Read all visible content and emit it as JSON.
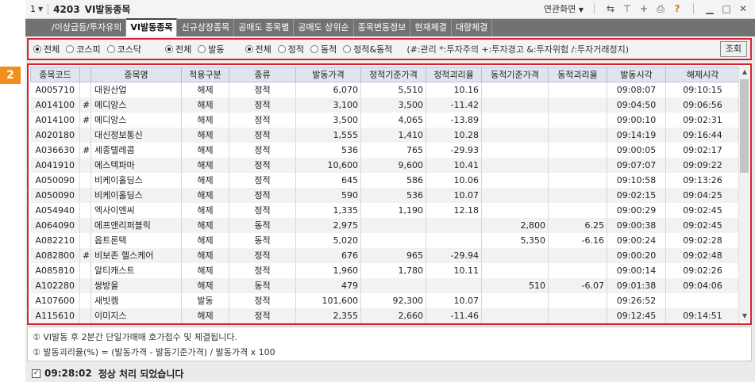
{
  "titlebar": {
    "screen_number": "1",
    "screen_code": "4203",
    "title": "VI발동종목",
    "linked_screen": "연관화면"
  },
  "icons": {
    "dropdown": "chevron-down-icon",
    "link": "link-icon",
    "pin": "pin-icon",
    "add": "plus-icon",
    "print": "print-icon",
    "help": "question-icon",
    "minimize": "minimize-icon",
    "maximize": "maximize-icon",
    "close": "close-icon"
  },
  "markers": [
    "1",
    "2"
  ],
  "tabs": [
    {
      "label": "/이상급등/투자유의",
      "active": false
    },
    {
      "label": "VI발동종목",
      "active": true
    },
    {
      "label": "신규상장종목",
      "active": false
    },
    {
      "label": "공매도 종목별",
      "active": false
    },
    {
      "label": "공매도 상위순",
      "active": false
    },
    {
      "label": "종목변동정보",
      "active": false
    },
    {
      "label": "현재체결",
      "active": false
    },
    {
      "label": "대량체결",
      "active": false
    }
  ],
  "filters": {
    "market": [
      {
        "label": "전체",
        "checked": true
      },
      {
        "label": "코스피",
        "checked": false
      },
      {
        "label": "코스닥",
        "checked": false
      }
    ],
    "status": [
      {
        "label": "전체",
        "checked": true
      },
      {
        "label": "발동",
        "checked": false
      }
    ],
    "type": [
      {
        "label": "전체",
        "checked": true
      },
      {
        "label": "정적",
        "checked": false
      },
      {
        "label": "동적",
        "checked": false
      },
      {
        "label": "정적&동적",
        "checked": false
      }
    ],
    "legend": "(#:관리 *:투자주의 +:투자경고 &:투자위험 /:투자거래정지)",
    "query_button": "조회"
  },
  "table": {
    "columns": [
      "종목코드",
      "",
      "종목명",
      "적용구분",
      "종류",
      "발동가격",
      "정적기준가격",
      "정적괴리율",
      "동적기준가격",
      "동적괴리율",
      "발동시각",
      "해제시각"
    ],
    "rows": [
      [
        "A005710",
        "",
        "대원산업",
        "해제",
        "정적",
        "6,070",
        "5,510",
        "10.16",
        "",
        "",
        "09:08:07",
        "09:10:15"
      ],
      [
        "A014100",
        "#",
        "메디앙스",
        "해제",
        "정적",
        "3,100",
        "3,500",
        "-11.42",
        "",
        "",
        "09:04:50",
        "09:06:56"
      ],
      [
        "A014100",
        "#",
        "메디앙스",
        "해제",
        "정적",
        "3,500",
        "4,065",
        "-13.89",
        "",
        "",
        "09:00:10",
        "09:02:31"
      ],
      [
        "A020180",
        "",
        "대신정보통신",
        "해제",
        "정적",
        "1,555",
        "1,410",
        "10.28",
        "",
        "",
        "09:14:19",
        "09:16:44"
      ],
      [
        "A036630",
        "#",
        "세종텔레콤",
        "해제",
        "정적",
        "536",
        "765",
        "-29.93",
        "",
        "",
        "09:00:05",
        "09:02:17"
      ],
      [
        "A041910",
        "",
        "에스텍파마",
        "해제",
        "정적",
        "10,600",
        "9,600",
        "10.41",
        "",
        "",
        "09:07:07",
        "09:09:22"
      ],
      [
        "A050090",
        "",
        "비케이홀딩스",
        "해제",
        "정적",
        "645",
        "586",
        "10.06",
        "",
        "",
        "09:10:58",
        "09:13:26"
      ],
      [
        "A050090",
        "",
        "비케이홀딩스",
        "해제",
        "정적",
        "590",
        "536",
        "10.07",
        "",
        "",
        "09:02:15",
        "09:04:25"
      ],
      [
        "A054940",
        "",
        "엑사이엔씨",
        "해제",
        "정적",
        "1,335",
        "1,190",
        "12.18",
        "",
        "",
        "09:00:29",
        "09:02:45"
      ],
      [
        "A064090",
        "",
        "에프앤리퍼블릭",
        "해제",
        "동적",
        "2,975",
        "",
        "",
        "2,800",
        "6.25",
        "09:00:38",
        "09:02:45"
      ],
      [
        "A082210",
        "",
        "옵트론텍",
        "해제",
        "동적",
        "5,020",
        "",
        "",
        "5,350",
        "-6.16",
        "09:00:24",
        "09:02:28"
      ],
      [
        "A082800",
        "#",
        "비보존 헬스케어",
        "해제",
        "정적",
        "676",
        "965",
        "-29.94",
        "",
        "",
        "09:00:20",
        "09:02:48"
      ],
      [
        "A085810",
        "",
        "알티캐스트",
        "해제",
        "정적",
        "1,960",
        "1,780",
        "10.11",
        "",
        "",
        "09:00:14",
        "09:02:26"
      ],
      [
        "A102280",
        "",
        "쌍방울",
        "해제",
        "동적",
        "479",
        "",
        "",
        "510",
        "-6.07",
        "09:01:38",
        "09:04:06"
      ],
      [
        "A107600",
        "",
        "새빗켐",
        "발동",
        "정적",
        "101,600",
        "92,300",
        "10.07",
        "",
        "",
        "09:26:52",
        ""
      ],
      [
        "A115610",
        "",
        "이미지스",
        "해제",
        "정적",
        "2,355",
        "2,660",
        "-11.46",
        "",
        "",
        "09:12:45",
        "09:14:51"
      ]
    ]
  },
  "notes": [
    "① VI발동 후 2분간 단일가매매 호가접수 및 체결됩니다.",
    "① 발동괴리율(%) = (발동가격 - 발동기준가격) / 발동가격 x 100"
  ],
  "status": {
    "time": "09:28:02",
    "message": "정상 처리 되었습니다"
  }
}
